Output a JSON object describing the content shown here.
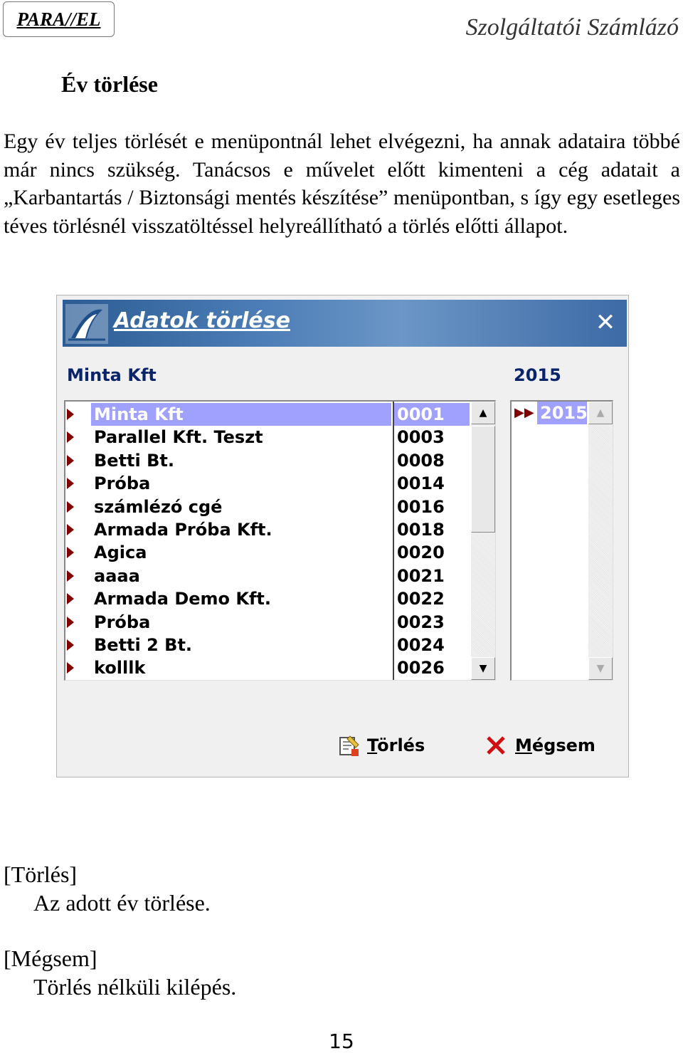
{
  "header": {
    "logo_text": "PARA//EL",
    "product_title": "Szolgáltatói Számlázó"
  },
  "section": {
    "title": "Év törlése",
    "intro": "Egy év teljes törlését e menüpontnál lehet elvégezni, ha annak adataira többé már nincs szükség. Tanácsos e művelet előtt kimenteni a cég adatait a „Karbantartás / Biztonsági mentés készítése” menüpontban, s így egy esetleges téves törlésnél visszatöltéssel helyreállítható a törlés előtti állapot."
  },
  "dialog": {
    "title": "Adatok törlése",
    "company_label": "Minta Kft",
    "year_label": "2015",
    "companies": [
      {
        "name": "Minta Kft",
        "code": "0001",
        "selected": true
      },
      {
        "name": "Parallel Kft. Teszt",
        "code": "0003"
      },
      {
        "name": "Betti Bt.",
        "code": "0008"
      },
      {
        "name": "Próba",
        "code": "0014"
      },
      {
        "name": "számlézó cgé",
        "code": "0016"
      },
      {
        "name": "Armada Próba Kft.",
        "code": "0018"
      },
      {
        "name": "Agica",
        "code": "0020"
      },
      {
        "name": "aaaa",
        "code": "0021"
      },
      {
        "name": "Armada Demo Kft.",
        "code": "0022"
      },
      {
        "name": "Próba",
        "code": "0023"
      },
      {
        "name": "Betti 2 Bt.",
        "code": "0024"
      },
      {
        "name": "kolllk",
        "code": "0026"
      }
    ],
    "years": [
      "2015"
    ],
    "delete_button": {
      "underlined": "T",
      "rest": "örlés"
    },
    "cancel_button": {
      "underlined": "M",
      "rest": "égsem"
    }
  },
  "help": [
    {
      "key": "[Törlés]",
      "desc": "Az adott év törlése."
    },
    {
      "key": "[Mégsem]",
      "desc": "Törlés nélküli kilépés."
    }
  ],
  "page_number": "15",
  "colors": {
    "selection": "#a0a0ff",
    "marker": "#800000",
    "label": "#0a246a",
    "titlebar": "#3d6aa5"
  }
}
